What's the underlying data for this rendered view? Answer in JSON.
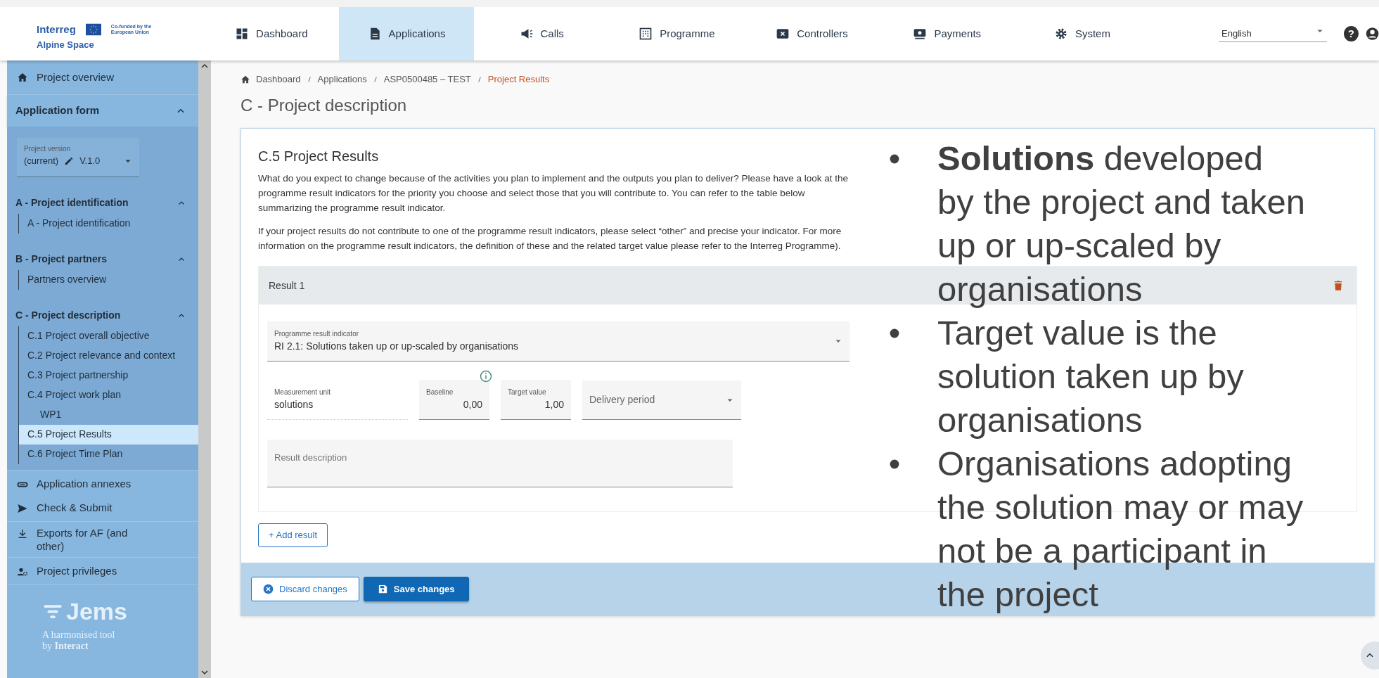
{
  "header": {
    "logo": {
      "brand": "Interreg",
      "cofunded": "Co-funded by the European Union",
      "programme": "Alpine Space"
    },
    "nav": [
      {
        "label": "Dashboard",
        "selected": false
      },
      {
        "label": "Applications",
        "selected": true
      },
      {
        "label": "Calls",
        "selected": false
      },
      {
        "label": "Programme",
        "selected": false
      },
      {
        "label": "Controllers",
        "selected": false
      },
      {
        "label": "Payments",
        "selected": false
      },
      {
        "label": "System",
        "selected": false
      }
    ],
    "language": "English",
    "help_label": "?"
  },
  "sidebar": {
    "top_items": [
      {
        "label": "Project overview"
      }
    ],
    "form_section": {
      "title": "Application form",
      "expanded": true,
      "version_field": {
        "label": "Project version",
        "value": "(current)",
        "version": "V.1.0"
      },
      "groups": [
        {
          "title": "A - Project identification",
          "expanded": true,
          "items": [
            {
              "label": "A - Project identification",
              "selected": false
            }
          ]
        },
        {
          "title": "B - Project partners",
          "expanded": true,
          "items": [
            {
              "label": "Partners overview",
              "selected": false
            }
          ]
        },
        {
          "title": "C - Project description",
          "expanded": true,
          "items": [
            {
              "label": "C.1 Project overall objective",
              "selected": false
            },
            {
              "label": "C.2 Project relevance and context",
              "selected": false
            },
            {
              "label": "C.3 Project partnership",
              "selected": false
            },
            {
              "label": "C.4 Project work plan",
              "selected": false,
              "children": [
                {
                  "label": "WP1",
                  "selected": false
                }
              ]
            },
            {
              "label": "C.5 Project Results",
              "selected": true
            },
            {
              "label": "C.6 Project Time Plan",
              "selected": false
            }
          ]
        }
      ]
    },
    "bottom_groups": [
      [
        {
          "label": "Application annexes"
        },
        {
          "label": "Check & Submit"
        }
      ],
      [
        {
          "label": "Exports for AF (and other)"
        }
      ],
      [
        {
          "label": "Project privileges"
        }
      ]
    ],
    "footer_logo": {
      "name": "Jems",
      "tagline": "A harmonised tool",
      "by": "by **Interact**"
    }
  },
  "breadcrumb": [
    {
      "label": "Dashboard",
      "current": false
    },
    {
      "label": "Applications",
      "current": false
    },
    {
      "label": "ASP0500485 – TEST",
      "current": false
    },
    {
      "label": "Project Results",
      "current": true
    }
  ],
  "page_title": "C - Project description",
  "card": {
    "title": "C.5 Project Results",
    "paragraphs": [
      "What do you expect to change because of the activities you plan to implement and the outputs you plan to deliver? Please have a look at the programme result indicators for the priority you choose and select those that you will contribute to. You can refer to the table below summarizing the programme result indicator.",
      "If your project results do not contribute to one of the programme result indicators, please select “other” and precise your indicator. For more information on the programme result indicators, the definition of these and the related target value please refer to the Interreg Programme)."
    ],
    "results": [
      {
        "title": "Result 1",
        "indicator": {
          "label": "Programme result indicator",
          "value": "RI 2.1: Solutions taken up or up-scaled by organisations"
        },
        "measurement_unit": {
          "label": "Measurement unit",
          "value": "solutions"
        },
        "baseline": {
          "label": "Baseline",
          "value": "0,00"
        },
        "target_value": {
          "label": "Target value",
          "value": "1,00"
        },
        "delivery_period": {
          "placeholder": "Delivery period"
        },
        "description": {
          "placeholder": "Result description"
        }
      }
    ],
    "add_button": "+ Add result",
    "footer_buttons": {
      "discard": "Discard changes",
      "save": "Save changes"
    }
  },
  "slide_overlay": {
    "bullets": [
      "**Solutions** developed by the project and taken up or up-scaled by organisations",
      "Target value is the solution taken up by organisations",
      "Organisations adopting the solution may or may not be a participant in the project"
    ]
  }
}
